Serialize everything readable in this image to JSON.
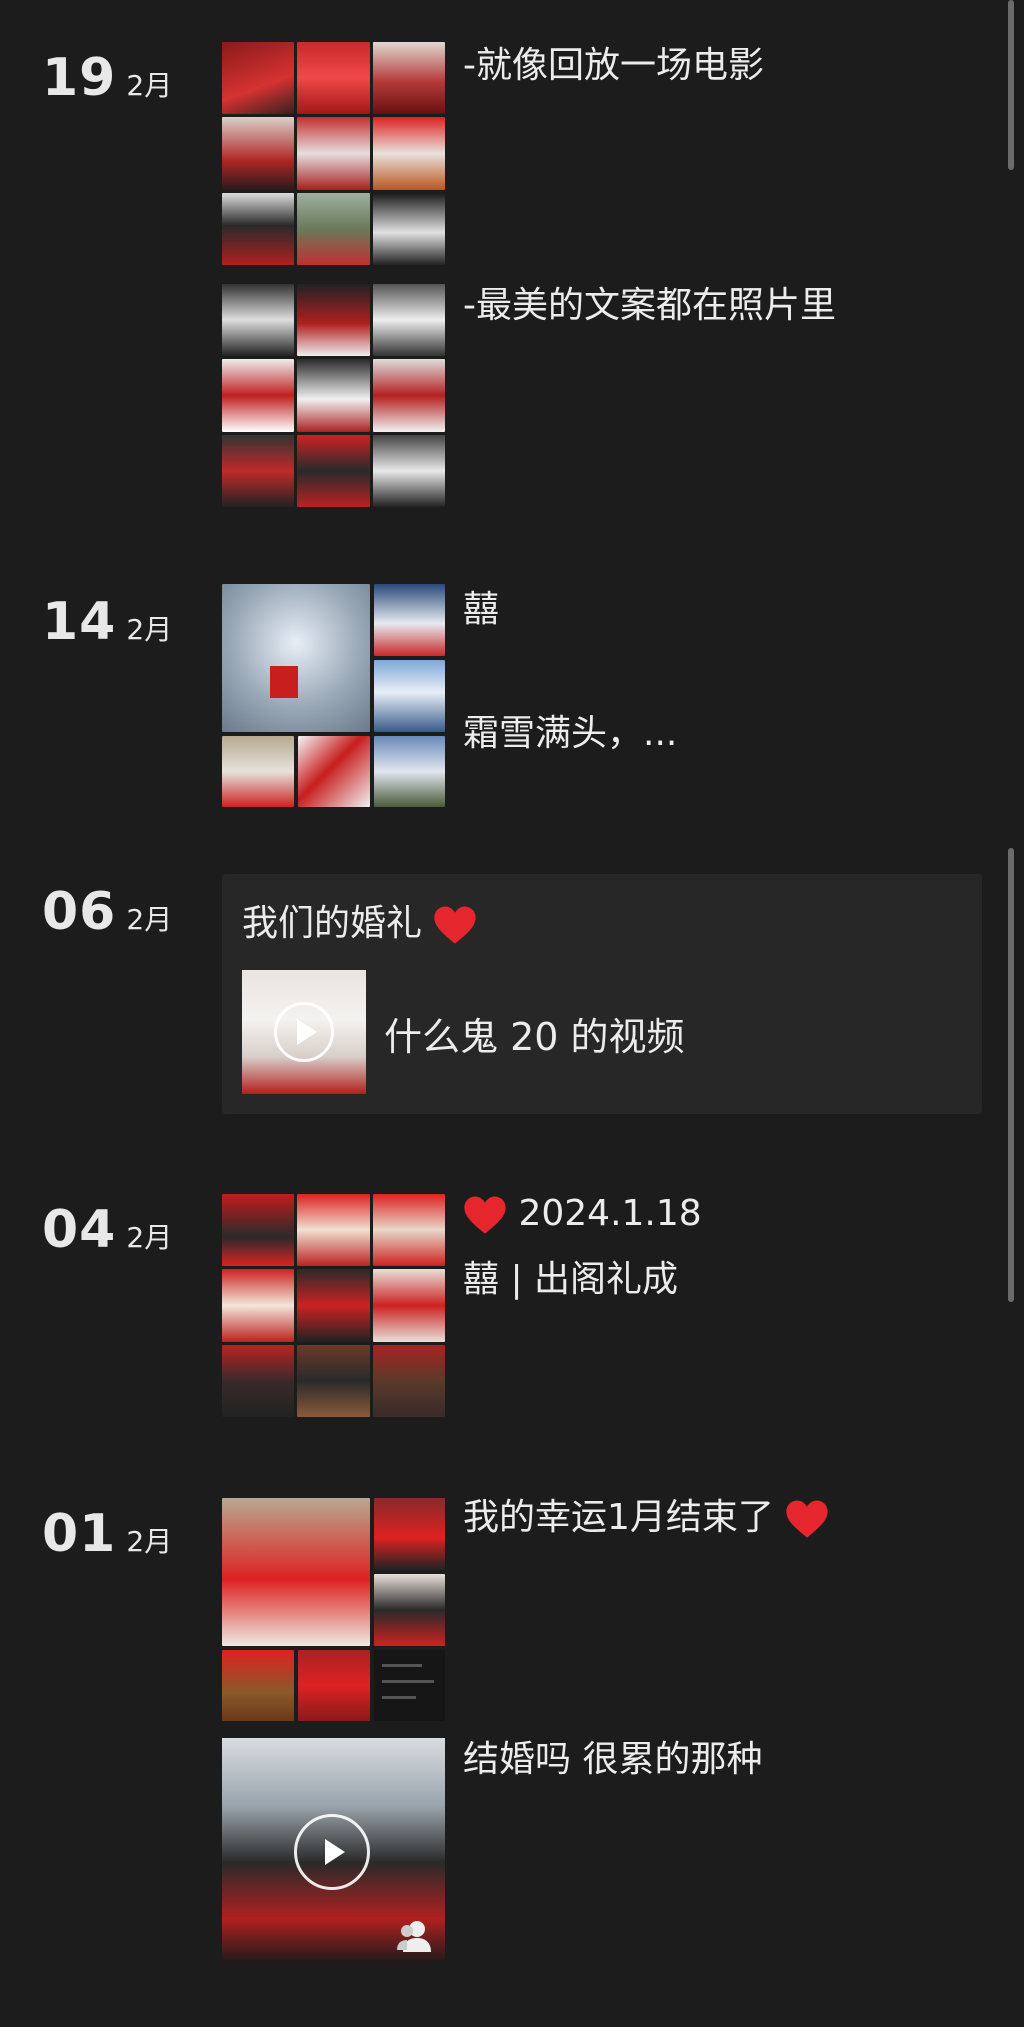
{
  "feed": {
    "entries": [
      {
        "day": "19",
        "month": "2月",
        "captions": [
          "-就像回放一场电影",
          "-最美的文案都在照片里"
        ]
      },
      {
        "day": "14",
        "month": "2月",
        "captions": [
          "囍",
          "霜雪满头，..."
        ]
      },
      {
        "day": "06",
        "month": "2月",
        "card_title": "我们的婚礼",
        "video_label": "什么鬼 20 的视频"
      },
      {
        "day": "04",
        "month": "2月",
        "captions": [
          "2024.1.18",
          "囍 | 出阁礼成"
        ]
      },
      {
        "day": "01",
        "month": "2月",
        "captions": [
          "我的幸运1月结束了",
          "结婚吗 很累的那种"
        ]
      }
    ]
  },
  "icons": [
    "heart-emoji-icon",
    "play-icon",
    "person-icon"
  ],
  "colors": {
    "background": "#1c1c1c",
    "card": "#272727",
    "text": "#ececec",
    "accent_red": "#d01f26"
  }
}
